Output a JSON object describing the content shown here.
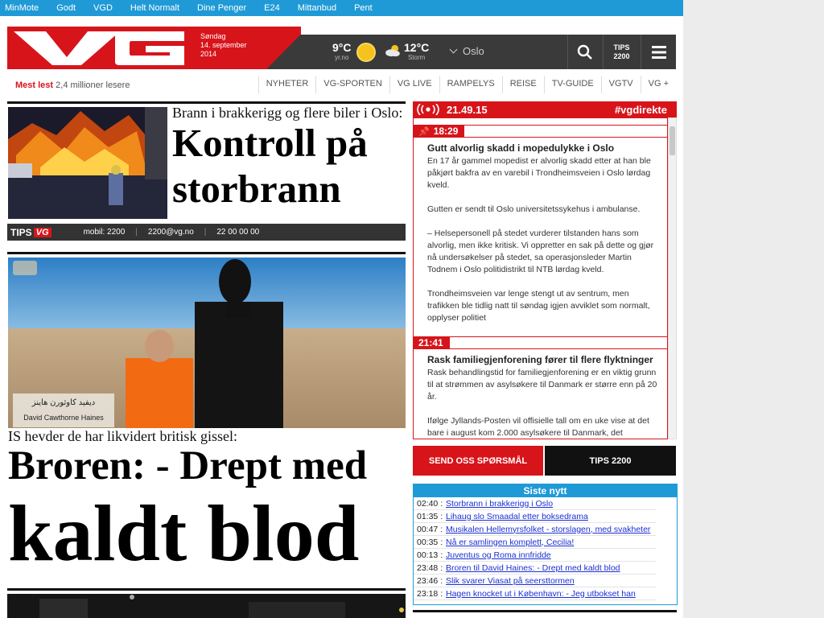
{
  "topnav": [
    "MinMote",
    "Godt",
    "VGD",
    "Helt Normalt",
    "Dine Penger",
    "E24",
    "Mittanbud",
    "Pent"
  ],
  "masthead": {
    "logo": "VG",
    "day": "Søndag",
    "date": "14. september",
    "year": "2014",
    "weather1": {
      "temp": "9°C",
      "source": "yr.no"
    },
    "weather2": {
      "temp": "12°C",
      "source": "Storm"
    },
    "city": "Oslo",
    "tips_line1": "TIPS",
    "tips_line2": "2200"
  },
  "sectionbar": {
    "most_read_label": "Mest lest",
    "readers": "2,4 millioner lesere",
    "sections": [
      "NYHETER",
      "VG-SPORTEN",
      "VG LIVE",
      "RAMPELYS",
      "REISE",
      "TV-GUIDE",
      "VGTV",
      "VG +"
    ]
  },
  "story1": {
    "kicker": "Brann i brakkerigg og flere biler i Oslo:",
    "headline_line1": "Kontroll på",
    "headline_line2": "storbrann"
  },
  "tipsbar": {
    "label": "TIPS",
    "brand": "VG",
    "mobile": "mobil: 2200",
    "email": "2200@vg.no",
    "phone": "22 00 00 00"
  },
  "story2": {
    "caption_arabic": "ديفيد كاوثورن هاينز",
    "caption_name": "David Cawthorne Haines",
    "kicker": "IS hevder de har likvidert britisk gissel:",
    "headline_line1": "Broren: - Drept med",
    "headline_line2": "kaldt blod"
  },
  "live": {
    "time": "21.49.15",
    "tag": "#vgdirekte",
    "entries": [
      {
        "stamp": "18:29",
        "pinned": true,
        "title": "Gutt alvorlig skadd i mopedulykke i Oslo",
        "body": "En 17 år gammel mopedist er alvorlig skadd etter at han ble påkjørt bakfra av en varebil i Trondheimsveien i Oslo lørdag kveld.\n\nGutten er sendt til Oslo universitetssykehus i ambulanse.\n\n– Helsepersonell på stedet vurderer tilstanden hans som alvorlig, men ikke kritisk. Vi oppretter en sak på dette og gjør nå undersøkelser på stedet, sa operasjonsleder Martin Todnem i Oslo politidistrikt til NTB lørdag kveld.\n\nTrondheimsveien var lenge stengt ut av sentrum, men trafikken ble tidlig natt til søndag igjen avviklet som normalt, opplyser politiet"
      },
      {
        "stamp": "21:41",
        "pinned": false,
        "title": "Rask familiegjenforening fører til flere flyktninger",
        "body": "Rask behandlingstid for familiegjenforening er en viktig grunn til at strømmen av asylsøkere til Danmark er større enn på 20 år.\n\nIfølge Jyllands-Posten vil offisielle tall om en uke vise at det bare i august kom 2.000 asylsøkere til Danmark, det"
      }
    ]
  },
  "buttons": {
    "send": "SEND OSS SPØRSMÅL",
    "tips": "TIPS 2200"
  },
  "latest": {
    "title": "Siste nytt",
    "items": [
      {
        "time": "02:40 :",
        "text": "Storbrann i brakkerigg i Oslo"
      },
      {
        "time": "01:35 :",
        "text": "Lihaug slo Smaadal etter boksedrama"
      },
      {
        "time": "00:47 :",
        "text": "Musikalen Hellemyrsfolket - storslagen, med svakheter"
      },
      {
        "time": "00:35 :",
        "text": "Nå er samlingen komplett, Cecilia!"
      },
      {
        "time": "00:13 :",
        "text": "Juventus og Roma innfridde"
      },
      {
        "time": "23:48 :",
        "text": "Broren til David Haines: - Drept med kaldt blod"
      },
      {
        "time": "23:46 :",
        "text": "Slik svarer Viasat på seersttormen"
      },
      {
        "time": "23:18 :",
        "text": "Hagen knocket ut i København: - Jeg utbokset han"
      }
    ]
  }
}
